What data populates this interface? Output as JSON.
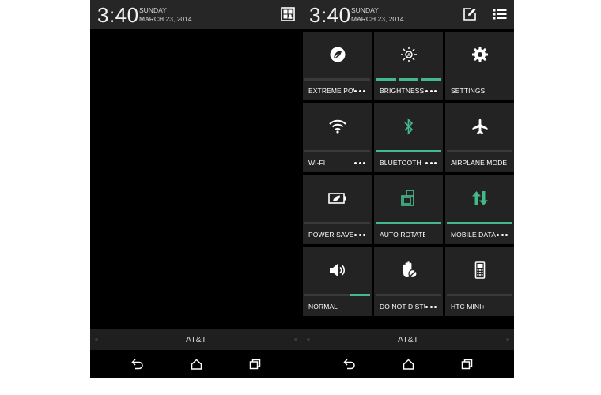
{
  "left_screen": {
    "status": {
      "time": "3:40",
      "day": "SUNDAY",
      "date": "MARCH 23, 2014",
      "icon": "contacts-card-icon"
    },
    "carrier": "AT&T",
    "nav": {
      "back": "back-icon",
      "home": "home-icon",
      "recents": "recents-icon"
    }
  },
  "right_screen": {
    "status": {
      "time": "3:40",
      "day": "SUNDAY",
      "date": "MARCH 23, 2014",
      "icons": [
        "edit-icon",
        "list-icon"
      ]
    },
    "tiles": [
      {
        "label": "EXTREME POWER SAVING",
        "icon": "extreme-power-icon",
        "has_more": true,
        "bar": "off"
      },
      {
        "label": "BRIGHTNESS",
        "icon": "brightness-icon",
        "has_more": true,
        "bar": "segments"
      },
      {
        "label": "SETTINGS",
        "icon": "settings-gear-icon",
        "has_more": false,
        "bar": "none"
      },
      {
        "label": "WI-FI",
        "icon": "wifi-icon",
        "has_more": true,
        "bar": "off"
      },
      {
        "label": "BLUETOOTH",
        "icon": "bluetooth-icon",
        "has_more": true,
        "bar": "on"
      },
      {
        "label": "AIRPLANE MODE",
        "icon": "airplane-icon",
        "has_more": false,
        "bar": "off"
      },
      {
        "label": "POWER SAVER",
        "icon": "battery-leaf-icon",
        "has_more": true,
        "bar": "off"
      },
      {
        "label": "AUTO ROTATE",
        "icon": "auto-rotate-icon",
        "has_more": false,
        "bar": "on"
      },
      {
        "label": "MOBILE DATA",
        "icon": "mobile-data-icon",
        "has_more": true,
        "bar": "on"
      },
      {
        "label": "NORMAL",
        "icon": "volume-icon",
        "has_more": false,
        "bar": "partial"
      },
      {
        "label": "DO NOT DISTURB",
        "icon": "do-not-disturb-icon",
        "has_more": true,
        "bar": "off"
      },
      {
        "label": "HTC MINI+",
        "icon": "htc-mini-icon",
        "has_more": false,
        "bar": "off"
      }
    ],
    "carrier": "AT&T",
    "nav": {
      "back": "back-icon",
      "home": "home-icon",
      "recents": "recents-icon"
    }
  },
  "colors": {
    "accent": "#44b78b",
    "tile": "#232323",
    "status_bar": "#262626",
    "bar_off": "#3a3a3a"
  }
}
